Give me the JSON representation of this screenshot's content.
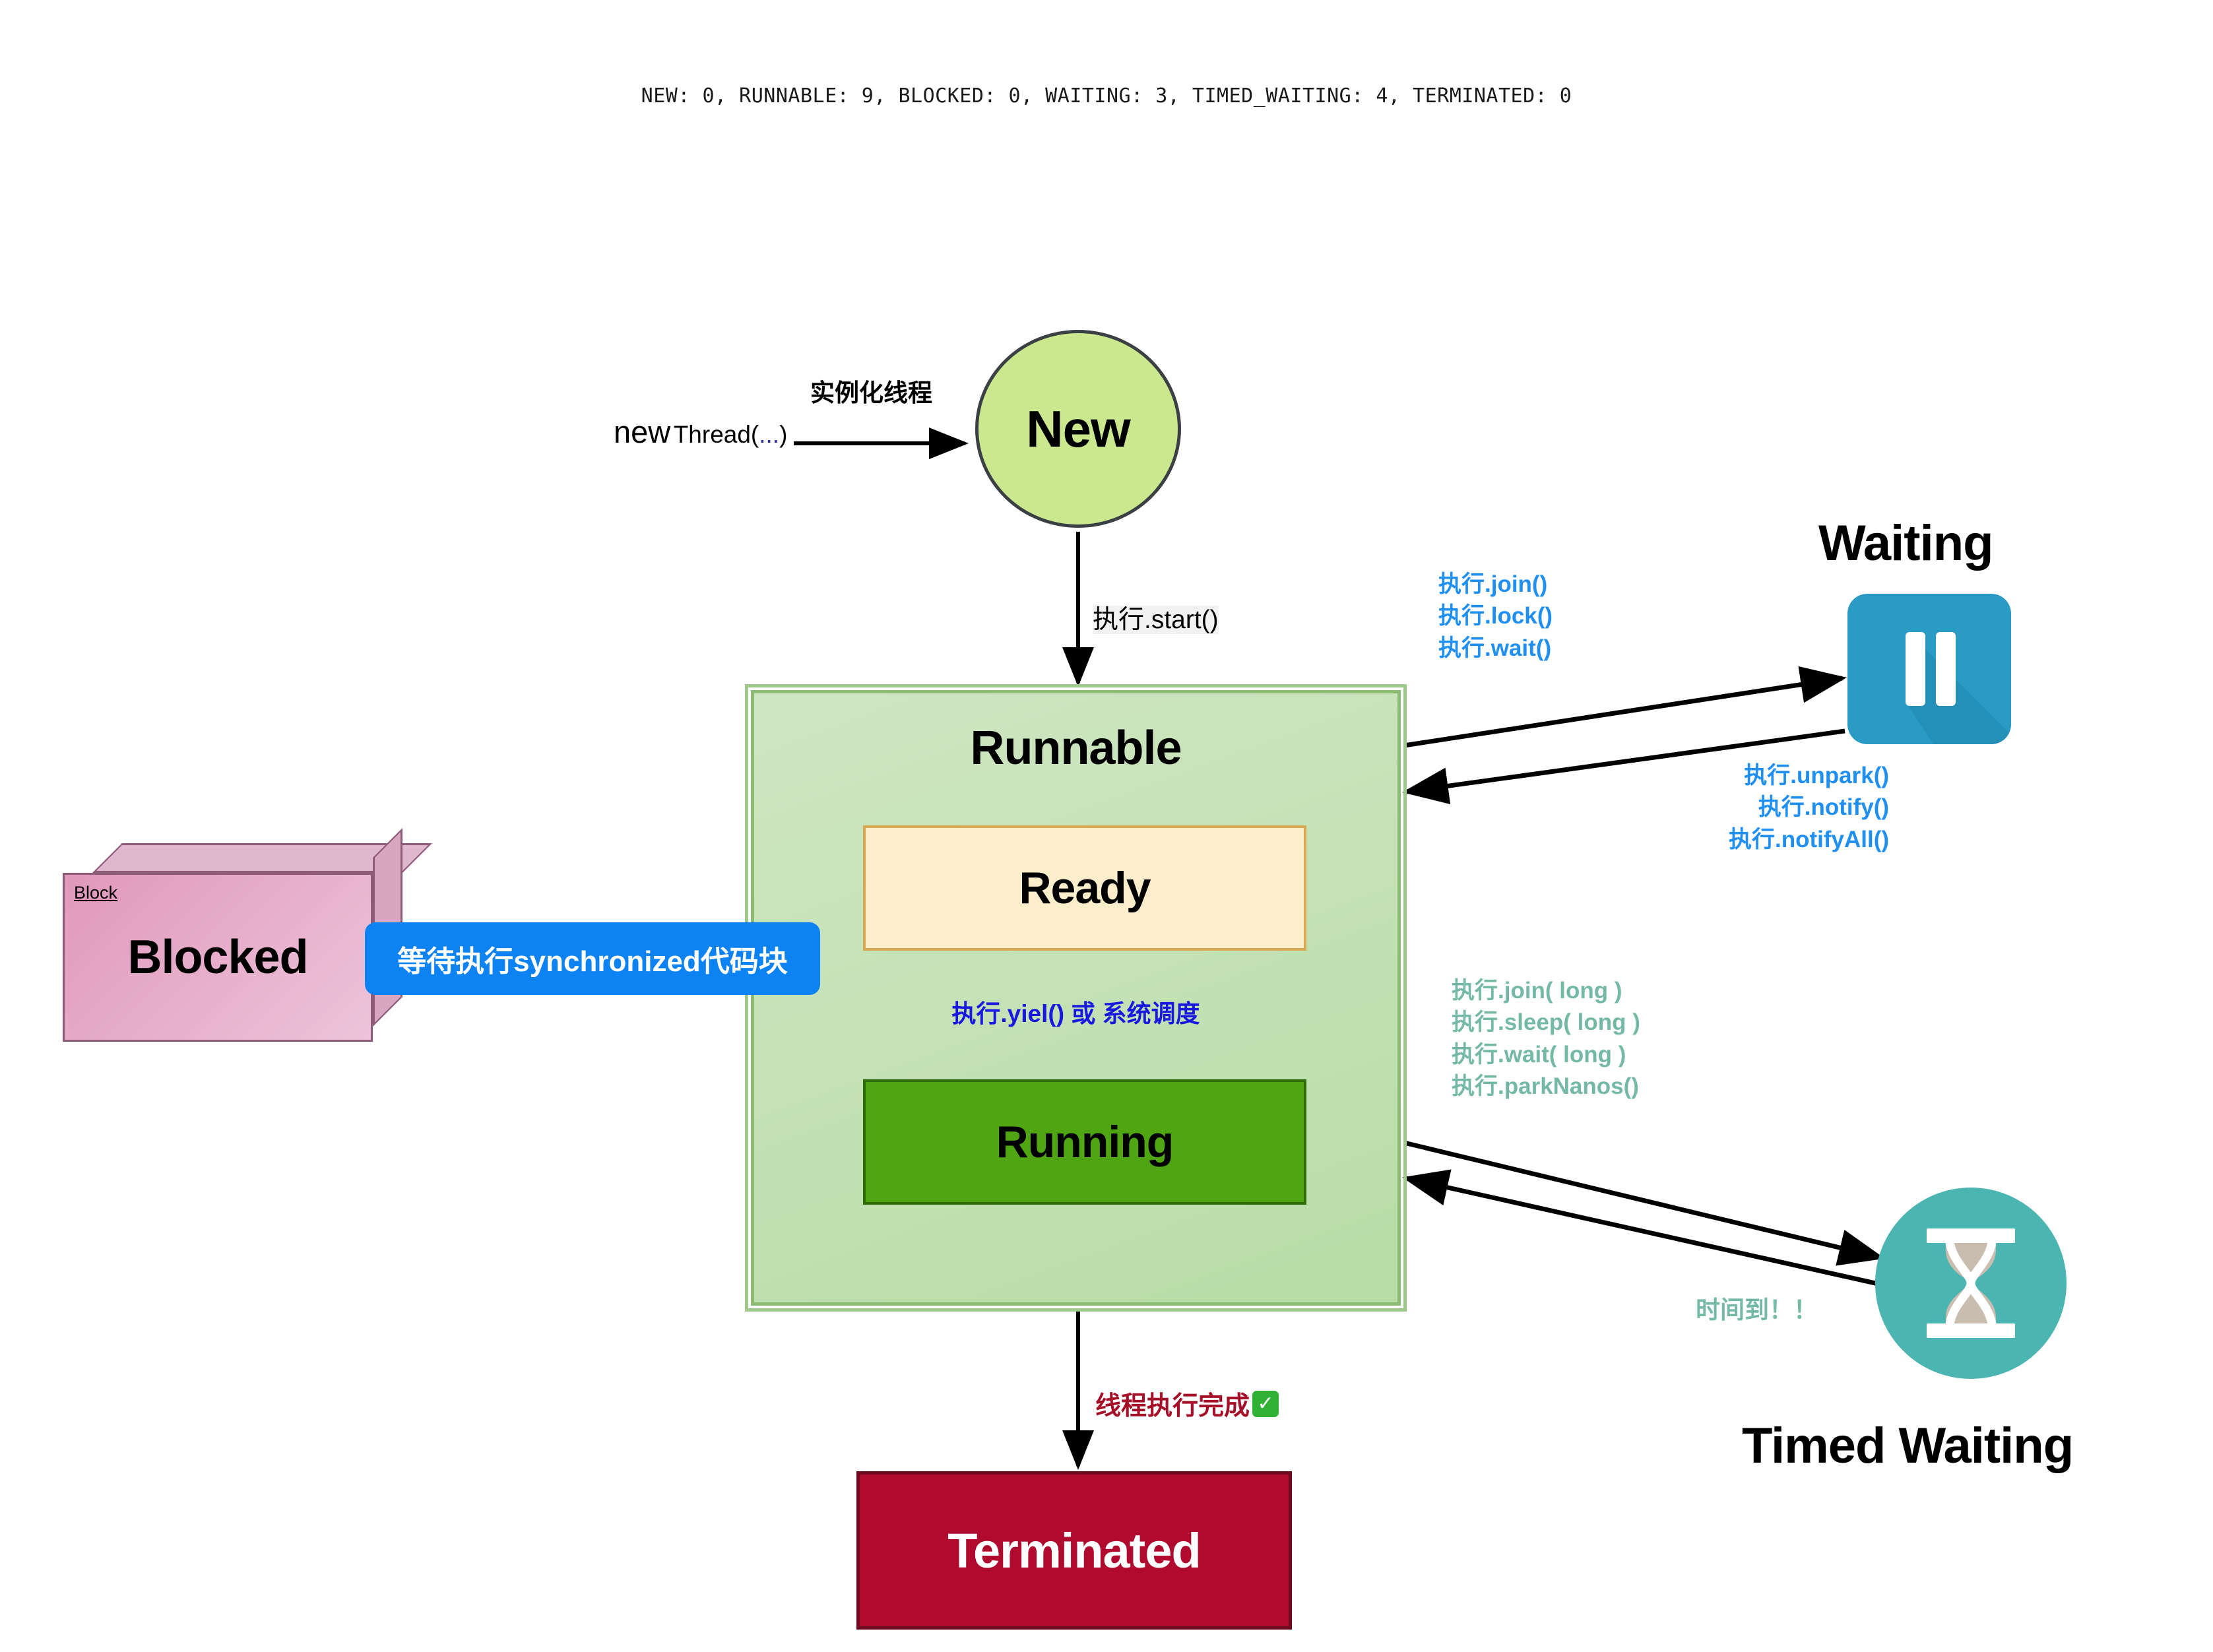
{
  "header": {
    "status_line": "NEW: 0, RUNNABLE: 9, BLOCKED: 0, WAITING: 3, TIMED_WAITING: 4, TERMINATED: 0"
  },
  "states": {
    "new": {
      "label": "New"
    },
    "runnable": {
      "label": "Runnable"
    },
    "ready": {
      "label": "Ready"
    },
    "running": {
      "label": "Running"
    },
    "blocked": {
      "label": "Blocked",
      "tag": "Block"
    },
    "waiting": {
      "label": "Waiting",
      "icon": "pause-icon"
    },
    "timed_waiting": {
      "label": "Timed Waiting",
      "icon": "hourglass-icon"
    },
    "terminated": {
      "label": "Terminated"
    }
  },
  "transitions": {
    "instantiate_title": "实例化线程",
    "new_thread_kw": "new",
    "new_thread_fn": "Thread(",
    "new_thread_dots": "...",
    "new_thread_close": ")",
    "start": "执行.start()",
    "yield_or_schedule": "执行.yiel() 或 系统调度",
    "sync_tooltip": "等待执行synchronized代码块",
    "finish": "线程执行完成",
    "finish_tick": "✓",
    "timed_done": "时间到！！"
  },
  "waiting_in_labels": [
    "执行.join()",
    "执行.lock()",
    "执行.wait()"
  ],
  "waiting_out_labels": [
    "执行.unpark()",
    "执行.notify()",
    "执行.notifyAll()"
  ],
  "timed_in_labels": [
    "执行.join( long )",
    "执行.sleep( long )",
    "执行.wait( long )",
    "执行.parkNanos()"
  ],
  "colors": {
    "new_fill": "#cbe88f",
    "runnable_fill": "#b8dda6",
    "ready_fill": "#fdeecb",
    "running_fill": "#4fa512",
    "blocked_fill": "#e098bc",
    "waiting_fill": "#2a9bc4",
    "timed_fill": "#4bb5b2",
    "terminated_fill": "#b00a2e",
    "blue_label": "#1f8ff2",
    "teal_label": "#74b9a5",
    "yield_label": "#1818e0",
    "finish_label": "#a60f28",
    "tooltip_bg": "#0d82f2"
  }
}
